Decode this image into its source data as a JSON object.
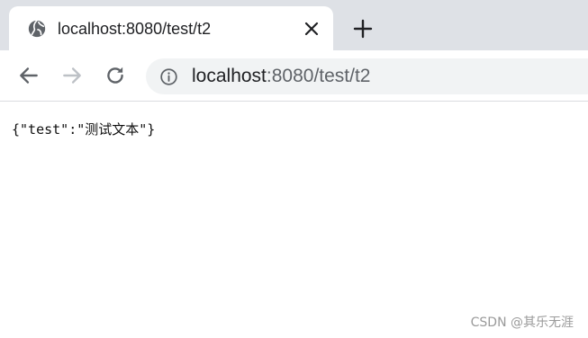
{
  "tab": {
    "title": "localhost:8080/test/t2",
    "favicon": "globe-icon",
    "close_icon": "close-icon"
  },
  "new_tab_icon": "plus-icon",
  "toolbar": {
    "back_icon": "arrow-left-icon",
    "forward_icon": "arrow-right-icon",
    "reload_icon": "reload-icon"
  },
  "address_bar": {
    "info_icon": "info-icon",
    "url_host": "localhost",
    "url_rest": ":8080/test/t2"
  },
  "page": {
    "body_text": "{\"test\":\"测试文本\"}"
  },
  "watermark": "CSDN @其乐无涯",
  "colors": {
    "tabstrip": "#dee1e6",
    "omnibox": "#f1f3f4",
    "icon": "#5f6368",
    "icon_disabled": "#bdc1c6"
  }
}
